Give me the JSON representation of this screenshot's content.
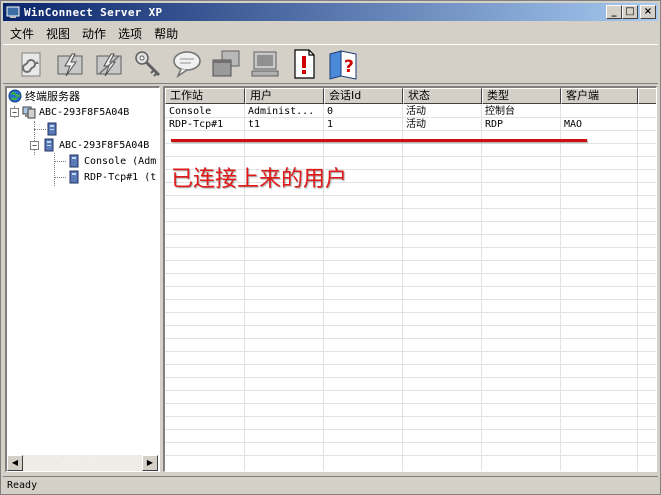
{
  "window": {
    "title": "WinConnect Server XP"
  },
  "title_buttons": {
    "minimize": "_",
    "maximize": "□",
    "close": "×"
  },
  "menu": [
    "文件",
    "视图",
    "动作",
    "选项",
    "帮助"
  ],
  "toolbar": [
    {
      "icon": "refresh-icon"
    },
    {
      "icon": "connect-icon"
    },
    {
      "icon": "disconnect-icon"
    },
    {
      "icon": "key-icon"
    },
    {
      "icon": "message-icon"
    },
    {
      "icon": "windows-icon"
    },
    {
      "icon": "computer-icon"
    },
    {
      "icon": "alert-icon"
    },
    {
      "icon": "help-book-icon"
    }
  ],
  "tree": {
    "root": "终端服务器",
    "server1": "ABC-293F8F5A04B",
    "server2": "ABC-293F8F5A04B",
    "session1": "Console (Adm",
    "session2": "RDP-Tcp#1 (t"
  },
  "table": {
    "columns": [
      "工作站",
      "用户",
      "会话Id",
      "状态",
      "类型",
      "客户端"
    ],
    "rows": [
      [
        "Console",
        "Administ...",
        "0",
        "活动",
        "控制台",
        ""
      ],
      [
        "RDP-Tcp#1",
        "t1",
        "1",
        "活动",
        "RDP",
        "MAO"
      ]
    ]
  },
  "annotation": "已连接上来的用户",
  "status": "Ready",
  "colors": {
    "annotation": "#e01818",
    "titlebar_start": "#0a246a",
    "titlebar_end": "#a6caf0"
  }
}
